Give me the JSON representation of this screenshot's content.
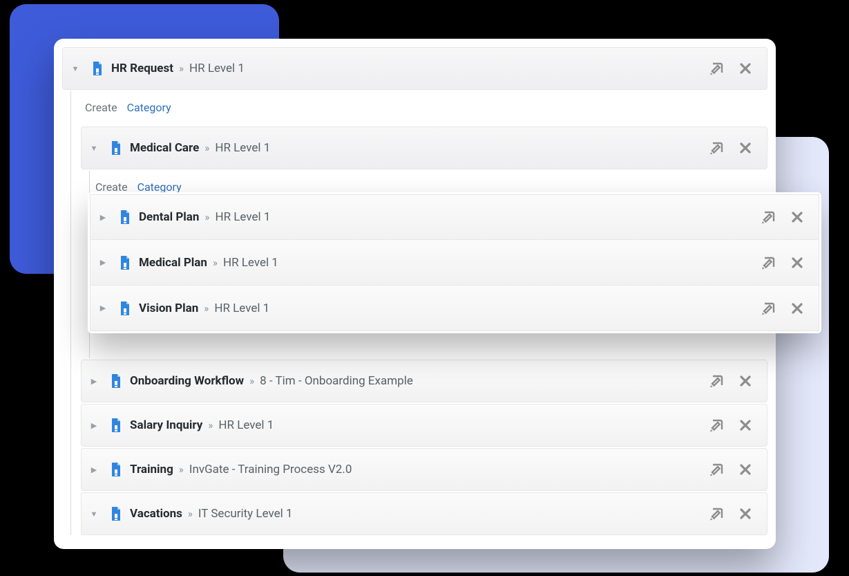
{
  "colors": {
    "brandBlueSolid": "#3e5bd9",
    "brandBlueLight": "#e4e8fb",
    "iconBlue": "#2f86e0",
    "linkBlue": "#2f6fbe"
  },
  "labels": {
    "create": "Create",
    "category": "Category"
  },
  "root": {
    "title": "HR Request",
    "sub": "HR Level 1",
    "expanded": true,
    "children": [
      {
        "title": "Medical Care",
        "sub": "HR Level 1",
        "expanded": true,
        "children": [
          {
            "title": "Dental Plan",
            "sub": "HR Level 1",
            "expanded": false
          },
          {
            "title": "Medical Plan",
            "sub": "HR Level 1",
            "expanded": false
          },
          {
            "title": "Vision Plan",
            "sub": "HR Level 1",
            "expanded": false
          }
        ]
      },
      {
        "title": "Onboarding Workflow",
        "sub": "8 - Tim - Onboarding Example",
        "expanded": false
      },
      {
        "title": "Salary Inquiry",
        "sub": "HR Level 1",
        "expanded": false
      },
      {
        "title": "Training",
        "sub": "InvGate - Training Process V2.0",
        "expanded": false
      },
      {
        "title": "Vacations",
        "sub": "IT Security Level 1",
        "expanded": true
      }
    ]
  }
}
